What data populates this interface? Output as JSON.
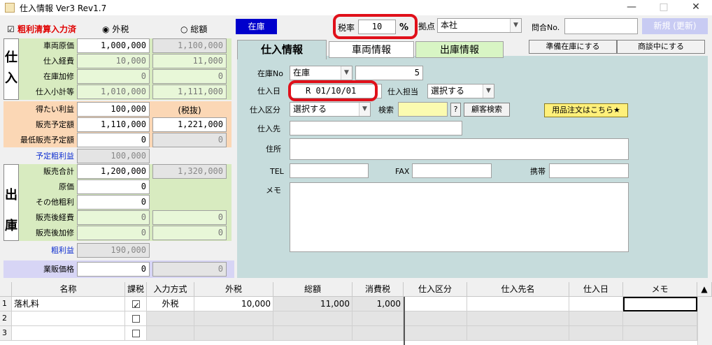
{
  "window": {
    "title": "仕入情報 Ver3 Rev1.7",
    "minimize": "—",
    "maximize": "□",
    "close": "✕"
  },
  "header": {
    "settlement_check_label": "粗利清算入力済",
    "radio_tax_excl": "外税",
    "radio_total": "総額",
    "stock_button": "在庫",
    "tax_rate_label": "税率",
    "tax_rate_value": "10",
    "tax_rate_unit": "%",
    "base_label": "拠点",
    "base_value": "本社",
    "inquiry_label": "問合No.",
    "inquiry_value": "",
    "new_button": "新規 (更新)"
  },
  "left": {
    "purchase_section": "仕入",
    "sales_section": "出庫",
    "rows": [
      {
        "label": "車両原価",
        "a": "1,000,000",
        "b": "1,100,000"
      },
      {
        "label": "仕入経費",
        "a": "10,000",
        "b": "11,000"
      },
      {
        "label": "在庫加修",
        "a": "0",
        "b": "0"
      },
      {
        "label": "仕入小計等",
        "a": "1,010,000",
        "b": "1,111,000"
      }
    ],
    "desired_profit_label": "得たい利益",
    "desired_profit_value": "100,000",
    "tax_excluded_note": "(税抜)",
    "planned_sale_label": "販売予定額",
    "planned_sale_a": "1,110,000",
    "planned_sale_b": "1,221,000",
    "min_sale_label": "最低販売予定額",
    "min_sale_a": "0",
    "min_sale_b": "0",
    "planned_gross_label": "予定粗利益",
    "planned_gross_value": "100,000",
    "sales_rows": [
      {
        "label": "販売合計",
        "a": "1,200,000",
        "b": "1,320,000"
      },
      {
        "label": "原価",
        "a": "0",
        "b": ""
      },
      {
        "label": "その他粗利",
        "a": "0",
        "b": ""
      },
      {
        "label": "販売後経費",
        "a": "0",
        "b": "0"
      },
      {
        "label": "販売後加修",
        "a": "0",
        "b": "0"
      }
    ],
    "gross_profit_label": "粗利益",
    "gross_profit_value": "190,000",
    "dealer_price_label": "業販価格",
    "dealer_price_a": "0",
    "dealer_price_b": "0"
  },
  "tabs": {
    "purchase": "仕入情報",
    "vehicle": "車両情報",
    "shipping": "出庫情報"
  },
  "actions": {
    "prep_stock": "準備在庫にする",
    "negotiating": "商談中にする"
  },
  "form": {
    "stock_no_label": "在庫No",
    "stock_no_type": "在庫",
    "stock_no_value": "5",
    "purchase_date_label": "仕入日",
    "purchase_date_value": "R 01/10/01",
    "staff_label": "仕入担当",
    "staff_value": "選択する",
    "category_label": "仕入区分",
    "category_value": "選択する",
    "search_label": "検索",
    "search_help": "?",
    "customer_search_button": "顧客検索",
    "order_button": "用品注文はこちら★",
    "supplier_label": "仕入先",
    "address_label": "住所",
    "tel_label": "TEL",
    "fax_label": "FAX",
    "mobile_label": "携帯",
    "memo_label": "メモ"
  },
  "grid": {
    "headers": [
      "名称",
      "課税",
      "入力方式",
      "外税",
      "総額",
      "消費税",
      "仕入区分",
      "仕入先名",
      "仕入日",
      "メモ"
    ],
    "rows": [
      {
        "no": "1",
        "name": "落札料",
        "taxable": true,
        "method": "外税",
        "excl": "10,000",
        "total": "11,000",
        "tax": "1,000"
      },
      {
        "no": "2",
        "name": "",
        "taxable": false,
        "method": "",
        "excl": "",
        "total": "",
        "tax": ""
      },
      {
        "no": "3",
        "name": "",
        "taxable": false,
        "method": "",
        "excl": "",
        "total": "",
        "tax": ""
      }
    ]
  }
}
